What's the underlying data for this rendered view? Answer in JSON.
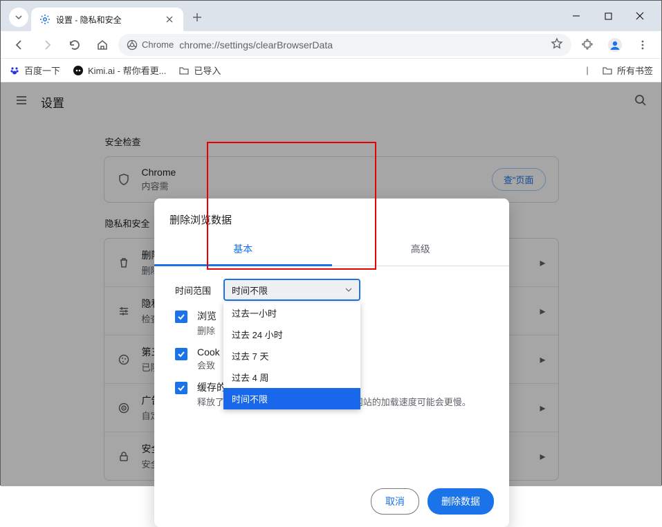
{
  "window": {
    "tab_title": "设置 - 隐私和安全"
  },
  "toolbar": {
    "address_chip": "Chrome",
    "url": "chrome://settings/clearBrowserData"
  },
  "bookmarks": {
    "baidu": "百度一下",
    "kimi": "Kimi.ai - 帮你看更...",
    "imported": "已导入",
    "all": "所有书签"
  },
  "settings": {
    "title": "设置",
    "security_check_heading": "安全检查",
    "row_chrome_l1": "Chrome",
    "row_chrome_l2": "内容需",
    "check_page_btn": "查\"页面",
    "privacy_heading": "隐私和安全",
    "r1_t1": "删除浏",
    "r1_t2": "删除历",
    "r2_t1": "隐私保",
    "r2_t2": "检查重",
    "r3_t1": "第三方",
    "r3_t2": "已阻止",
    "r4_t1": "广告隐",
    "r4_t2": "自定义",
    "r5_t1": "安全",
    "r5_t2": "安全浏览（保护您免受危险网站的侵害）和其他安全设置"
  },
  "modal": {
    "title": "删除浏览数据",
    "tab_basic": "基本",
    "tab_advanced": "高级",
    "time_range_label": "时间范围",
    "selected": "时间不限",
    "options": {
      "o1": "过去一小时",
      "o2": "过去 24 小时",
      "o3": "过去 7 天",
      "o4": "过去 4 周",
      "o5": "时间不限"
    },
    "c1_t1": "浏览",
    "c1_t2": "删除",
    "c2_t1": "Cook",
    "c2_t2": "会致",
    "c3_t1": "缓存的图片和文件",
    "c3_t2": "释放了 5.5 MB。当您下次访问时，某些网站的加载速度可能会更慢。",
    "cancel": "取消",
    "confirm": "删除数据"
  }
}
